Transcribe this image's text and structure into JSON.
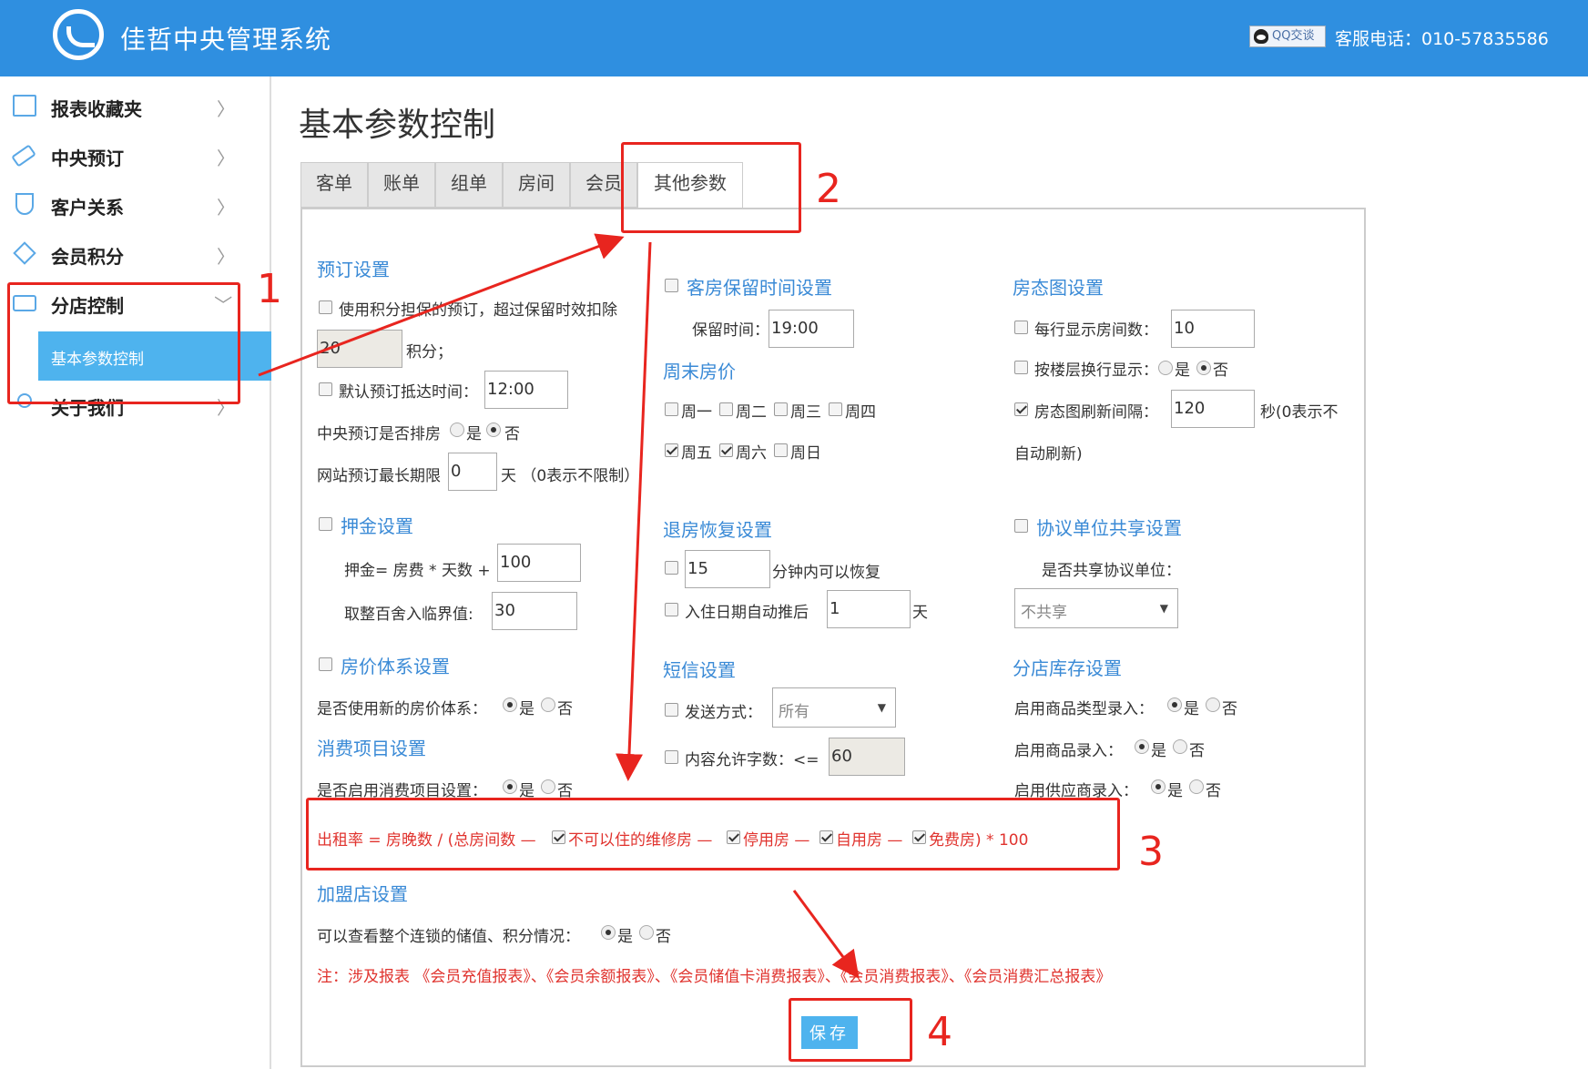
{
  "header": {
    "app_title": "佳哲中央管理系统",
    "qq_badge": "QQ交谈",
    "hotline": "客服电话：010-57835586"
  },
  "sidebar": {
    "items": [
      {
        "label": "报表收藏夹",
        "icon": "folder-icon"
      },
      {
        "label": "中央预订",
        "icon": "tag-icon"
      },
      {
        "label": "客户关系",
        "icon": "trophy-icon"
      },
      {
        "label": "会员积分",
        "icon": "diamond-icon"
      },
      {
        "label": "分店控制",
        "icon": "shop-icon",
        "expanded": true
      },
      {
        "label": "关于我们",
        "icon": "user-icon"
      }
    ],
    "sub_item": "基本参数控制"
  },
  "page_title": "基本参数控制",
  "tabs": [
    "客单",
    "账单",
    "组单",
    "房间",
    "会员",
    "其他参数"
  ],
  "active_tab": "其他参数",
  "booking": {
    "title": "预订设置",
    "use_points_label": "使用积分担保的预订，超过保留时效扣除",
    "points_value": "20",
    "points_unit": "积分；",
    "default_arrival_label": "默认预订抵达时间：",
    "default_arrival_value": "12:00",
    "central_assign_label": "中央预订是否排房",
    "yes": "是",
    "no": "否",
    "web_max_label": "网站预订最长期限",
    "web_max_value": "0",
    "web_max_unit": "天 （0表示不限制）"
  },
  "deposit": {
    "title": "押金设置",
    "formula_label": "押金= 房费 * 天数 +",
    "formula_value": "100",
    "round_label": "取整百舍入临界值:",
    "round_value": "30"
  },
  "price_system": {
    "title": "房价体系设置",
    "label": "是否使用新的房价体系：",
    "yes": "是",
    "no": "否"
  },
  "consumption": {
    "title": "消费项目设置",
    "label": "是否启用消费项目设置：",
    "yes": "是",
    "no": "否"
  },
  "hold_time": {
    "title": "客房保留时间设置",
    "label": "保留时间：",
    "value": "19:00"
  },
  "weekend": {
    "title": "周末房价",
    "days": [
      "周一",
      "周二",
      "周三",
      "周四",
      "周五",
      "周六",
      "周日"
    ],
    "checked": [
      false,
      false,
      false,
      false,
      true,
      true,
      false
    ]
  },
  "checkout_restore": {
    "title": "退房恢复设置",
    "minutes_value": "15",
    "minutes_label": "分钟内可以恢复",
    "auto_delay_label": "入住日期自动推后",
    "auto_delay_value": "1",
    "auto_delay_unit": "天"
  },
  "sms": {
    "title": "短信设置",
    "send_label": "发送方式：",
    "send_value": "所有",
    "length_label": "内容允许字数：<=",
    "length_value": "60"
  },
  "room_map": {
    "title": "房态图设置",
    "per_row_label": "每行显示房间数：",
    "per_row_value": "10",
    "floor_wrap_label": "按楼层换行显示：",
    "yes": "是",
    "no": "否",
    "refresh_label": "房态图刷新间隔：",
    "refresh_value": "120",
    "refresh_unit": "秒(0表示不",
    "refresh_unit2": "自动刷新)"
  },
  "agreement": {
    "title": "协议单位共享设置",
    "label": "是否共享协议单位：",
    "value": "不共享"
  },
  "inventory": {
    "title": "分店库存设置",
    "goods_type_label": "启用商品类型录入：",
    "goods_label": "启用商品录入：",
    "supplier_label": "启用供应商录入：",
    "yes": "是",
    "no": "否"
  },
  "occupancy": {
    "prefix": "出租率 = 房晚数 / (总房间数 —",
    "item1": "不可以住的维修房 —",
    "item2": "停用房 —",
    "item3": "自用房 —",
    "item4": "免费房) * 100"
  },
  "franchise": {
    "title": "加盟店设置",
    "label": "可以查看整个连锁的储值、积分情况：",
    "yes": "是",
    "no": "否",
    "note": "注：涉及报表 《会员充值报表》、《会员余额报表》、《会员储值卡消费报表》、《会员消费报表》、《会员消费汇总报表》"
  },
  "save_label": "保存",
  "annotations": [
    "1",
    "2",
    "3",
    "4"
  ],
  "colors": {
    "header_bg": "#2f8fe0",
    "accent": "#4eb3ee",
    "section_title": "#3a8ad6",
    "annotation": "#e8251f"
  }
}
